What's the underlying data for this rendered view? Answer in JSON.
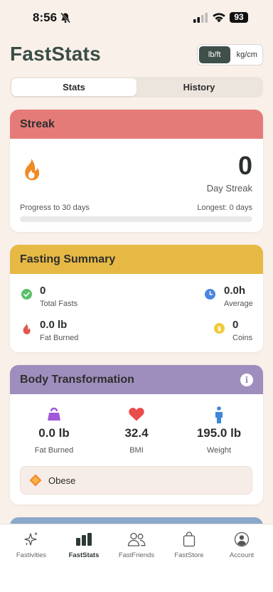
{
  "status_bar": {
    "time": "8:56",
    "battery": "93"
  },
  "header": {
    "title": "FastStats",
    "units": [
      "lb/ft",
      "kg/cm"
    ],
    "selected_unit": "lb/ft"
  },
  "tabs": [
    {
      "label": "Stats",
      "active": true
    },
    {
      "label": "History",
      "active": false
    }
  ],
  "streak": {
    "title": "Streak",
    "count": "0",
    "count_label": "Day Streak",
    "progress_label": "Progress to 30 days",
    "longest_label": "Longest: 0 days",
    "progress": 0
  },
  "fasting_summary": {
    "title": "Fasting Summary",
    "total_fasts": {
      "value": "0",
      "label": "Total Fasts"
    },
    "average": {
      "value": "0.0h",
      "label": "Average"
    },
    "fat_burned": {
      "value": "0.0 lb",
      "label": "Fat Burned"
    },
    "coins": {
      "value": "0",
      "label": "Coins"
    }
  },
  "body_transformation": {
    "title": "Body Transformation",
    "fat_burned": {
      "value": "0.0 lb",
      "label": "Fat Burned"
    },
    "bmi": {
      "value": "32.4",
      "label": "BMI"
    },
    "weight": {
      "value": "195.0 lb",
      "label": "Weight"
    },
    "bmi_category": "Obese"
  },
  "colors": {
    "streak": "#e57b78",
    "summary": "#e6b944",
    "body": "#9e8ebd",
    "accent_dark": "#3f4f4a"
  },
  "tab_bar": [
    {
      "label": "Fastivities",
      "icon": "sparkles-icon"
    },
    {
      "label": "FastStats",
      "icon": "bar-chart-icon",
      "active": true
    },
    {
      "label": "FastFriends",
      "icon": "people-icon"
    },
    {
      "label": "FastStore",
      "icon": "shopping-bag-icon"
    },
    {
      "label": "Account",
      "icon": "person-circle-icon"
    }
  ]
}
